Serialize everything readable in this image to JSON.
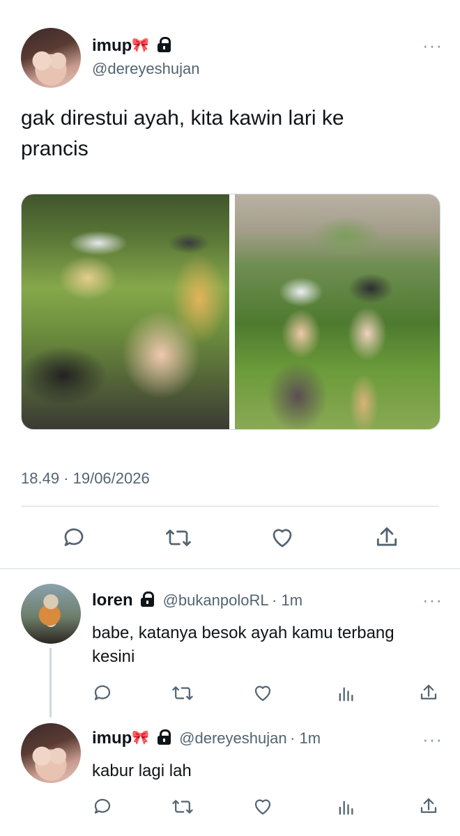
{
  "main_tweet": {
    "author_name": "imup",
    "name_emoji": "🎀",
    "handle": "@dereyeshujan",
    "text": "gak direstui ayah, kita kawin lari ke prancis",
    "timestamp": "18.49 · 19/06/2026",
    "more_label": "···",
    "images": [
      "photo-left",
      "photo-right"
    ]
  },
  "replies": [
    {
      "author_name": "loren",
      "handle": "@bukanpoloRL",
      "time": "· 1m",
      "text": "babe, katanya besok ayah kamu terbang kesini"
    },
    {
      "author_name": "imup",
      "name_emoji": "🎀",
      "handle": "@dereyeshujan",
      "time": "· 1m",
      "text": "kabur lagi lah"
    }
  ],
  "icons": {
    "reply": "reply-icon",
    "retweet": "retweet-icon",
    "like": "like-icon",
    "views": "views-icon",
    "share": "share-icon",
    "lock": "lock-icon"
  },
  "colors": {
    "text": "#0f1419",
    "secondary": "#536471",
    "divider": "#cfd9de"
  }
}
